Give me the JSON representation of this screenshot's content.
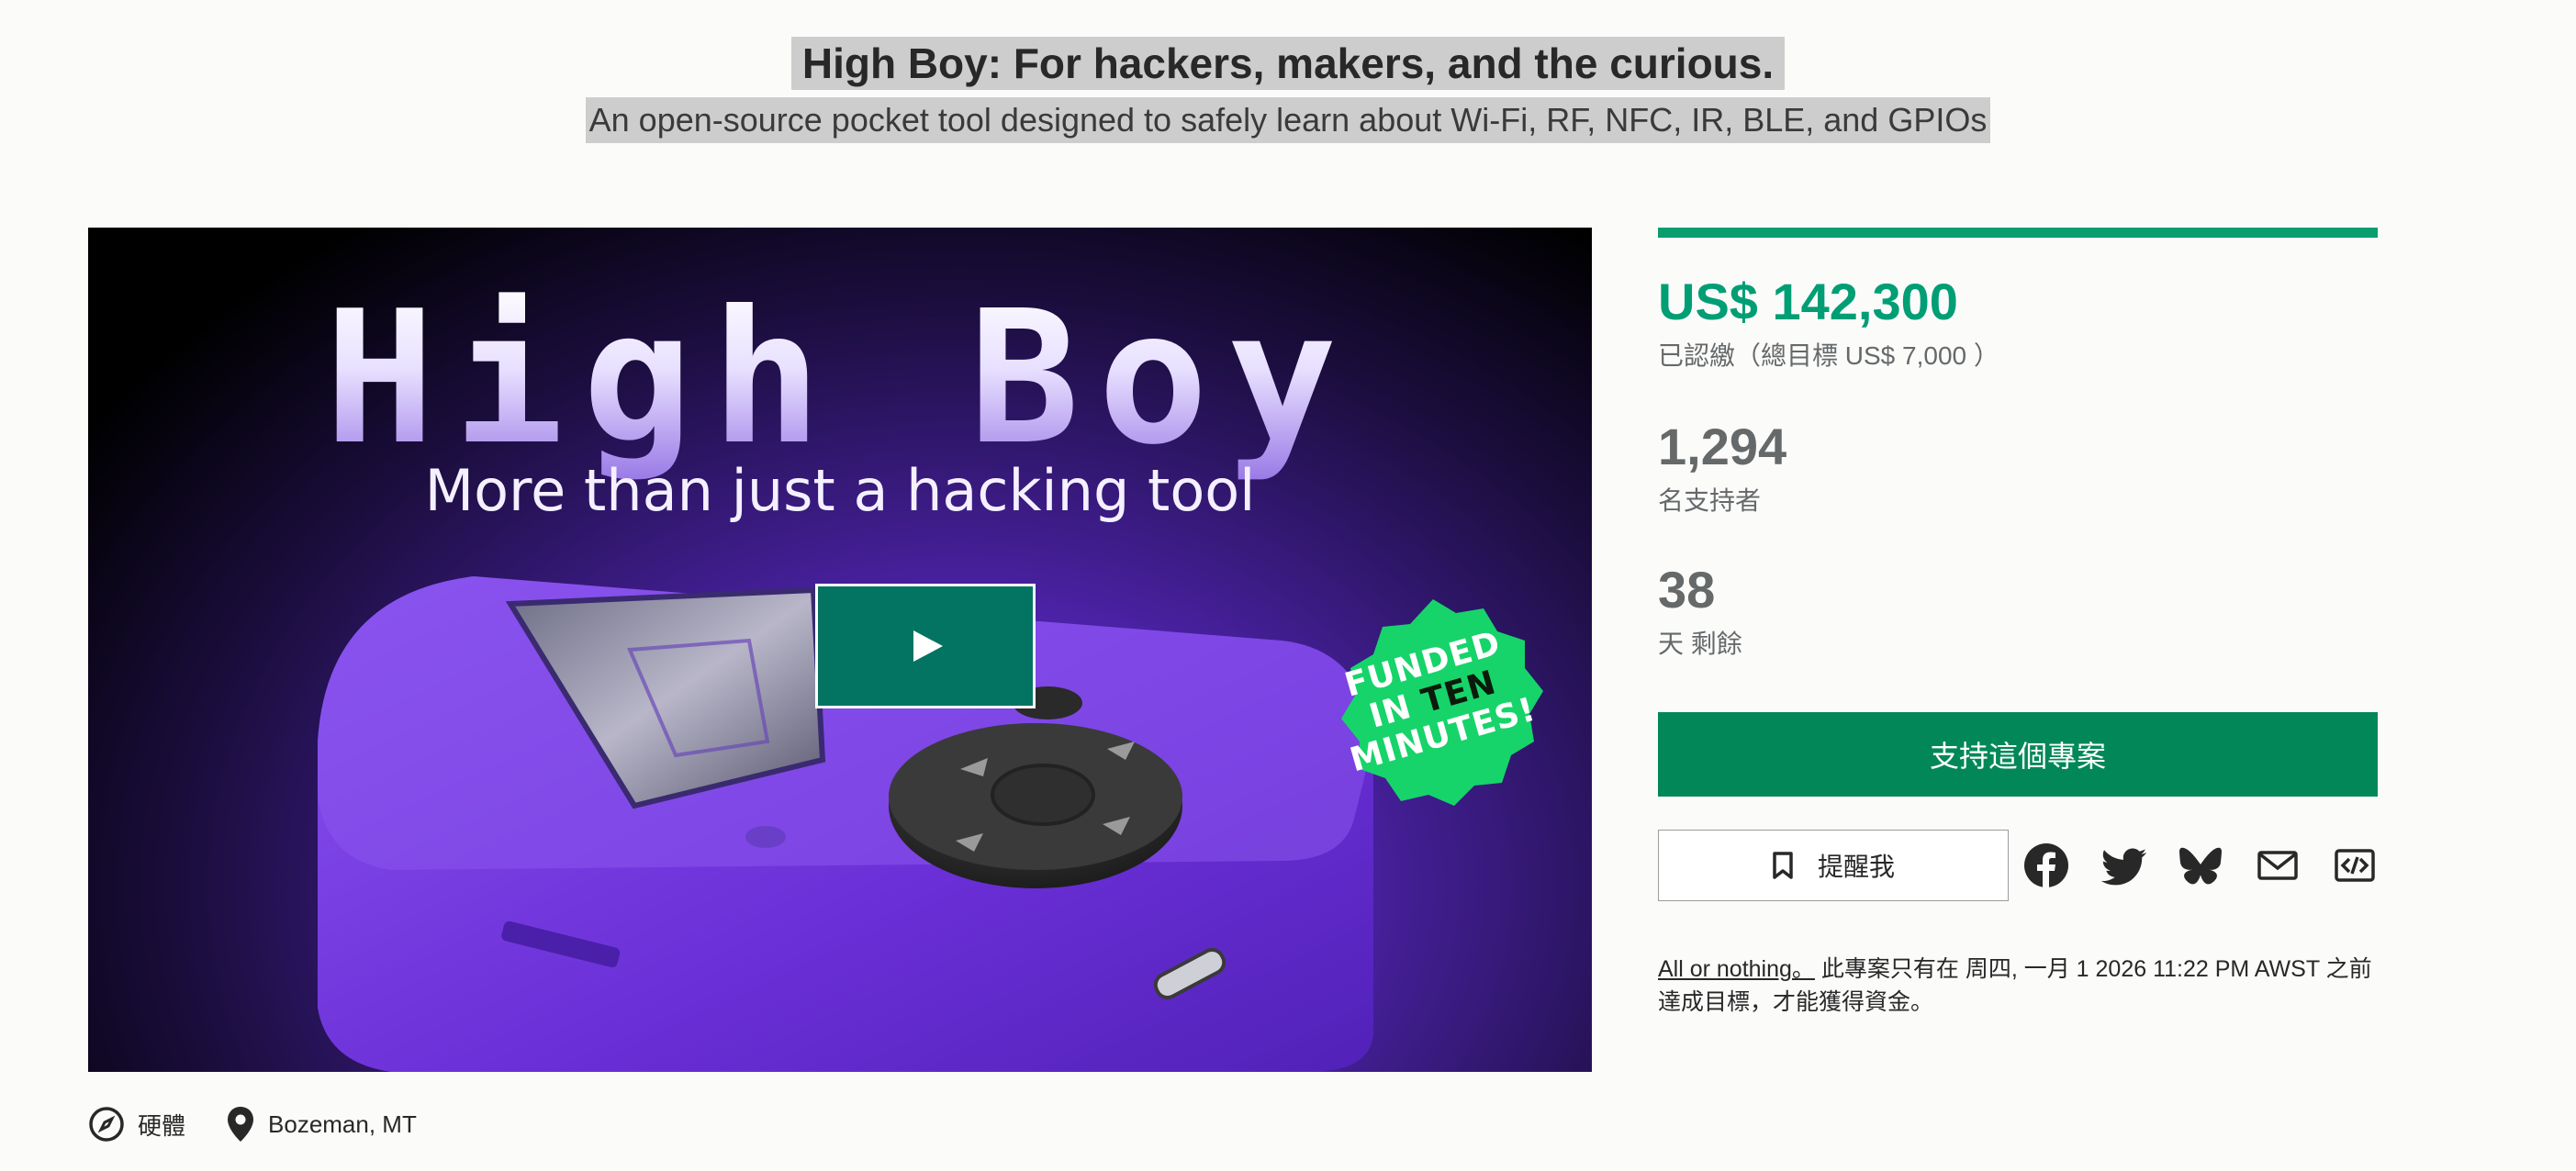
{
  "project": {
    "title": "High Boy: For hackers, makers, and the curious.",
    "subtitle": "An open-source pocket tool designed to safely learn about Wi-Fi, RF, NFC, IR, BLE, and GPIOs"
  },
  "hero": {
    "logo_text": "High Boy",
    "tagline": "More than just a hacking tool",
    "badge": {
      "line1": "FUNDED",
      "line2_a": "IN",
      "line2_b": "TEN",
      "line3": "MINUTES!"
    },
    "play_icon": "play-icon"
  },
  "meta": {
    "category": {
      "icon": "compass-icon",
      "label": "硬體"
    },
    "location": {
      "icon": "map-pin-icon",
      "label": "Bozeman, MT"
    }
  },
  "funding": {
    "progress_fraction": 1.0,
    "pledged": "US$ 142,300",
    "pledged_label": "已認繳（總目標 US$ 7,000 ）",
    "backers": "1,294",
    "backers_label": "名支持者",
    "days": "38",
    "days_label": "天 剩餘"
  },
  "actions": {
    "back_label": "支持這個專案",
    "remind_label": "提醒我",
    "remind_icon": "bookmark-icon",
    "share_icons": [
      "facebook-icon",
      "twitter-icon",
      "bluesky-icon",
      "email-icon",
      "embed-icon"
    ]
  },
  "fine_print": {
    "link": "All or nothing。",
    "text_line1": " 此專案只有在 周四, 一月 1 2026 11:22 PM AWST 之前",
    "text_line2": "達成目標，才能獲得資金。"
  },
  "colors": {
    "accent": "#009e74",
    "button_green": "#028858",
    "play_button": "#037362",
    "badge_green": "#16d46a",
    "device_purple": "#7a3fe0"
  }
}
